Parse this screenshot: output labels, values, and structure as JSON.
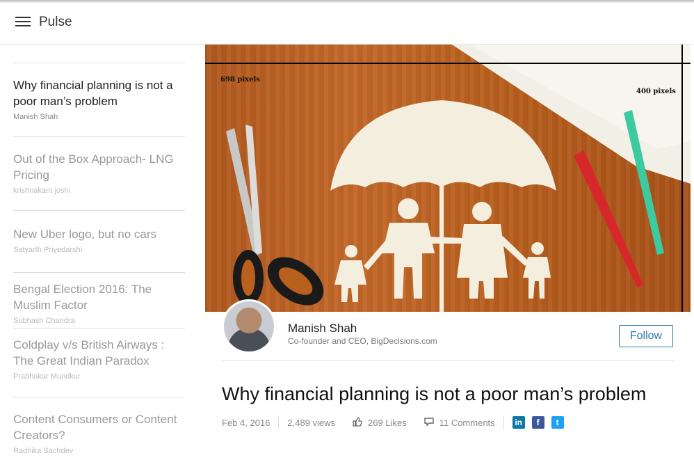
{
  "header": {
    "brand": "Pulse",
    "menu_icon": "hamburger-menu-icon"
  },
  "sidebar": {
    "items": [
      {
        "title": "Why financial planning is not a poor man’s problem",
        "author": "Manish Shah",
        "active": true
      },
      {
        "title": "Out of the Box Approach- LNG Pricing",
        "author": "krishnakant joshi"
      },
      {
        "title": "New Uber logo, but no cars",
        "author": "Satyarth Priyedarshi"
      },
      {
        "title": "Bengal Election 2016: The Muslim Factor",
        "author": "Subhash Chandra"
      },
      {
        "title": "Coldplay v/s British Airways : The Great Indian Paradox",
        "author": "Prabhakar Mundkur"
      },
      {
        "title": "Content Consumers or Content Creators?",
        "author": "Radhika Sachdev"
      }
    ]
  },
  "hero": {
    "width_label": "698 pixels",
    "height_label": "400 pixels",
    "wood_color": "#b9601f"
  },
  "author": {
    "name": "Manish Shah",
    "role": "Co-founder and CEO, BigDecisions.com",
    "follow_label": "Follow"
  },
  "article": {
    "title": "Why financial planning is not a poor man’s problem",
    "date": "Feb 4, 2016",
    "views": "2,489 views",
    "likes": "269 Likes",
    "comments": "11 Comments",
    "share": {
      "linkedin": "in",
      "facebook": "f",
      "twitter": "t"
    }
  },
  "colors": {
    "accent": "#2a7ab0",
    "linkedin": "#0e76a8",
    "facebook": "#3b5998",
    "twitter": "#1da1f2"
  }
}
